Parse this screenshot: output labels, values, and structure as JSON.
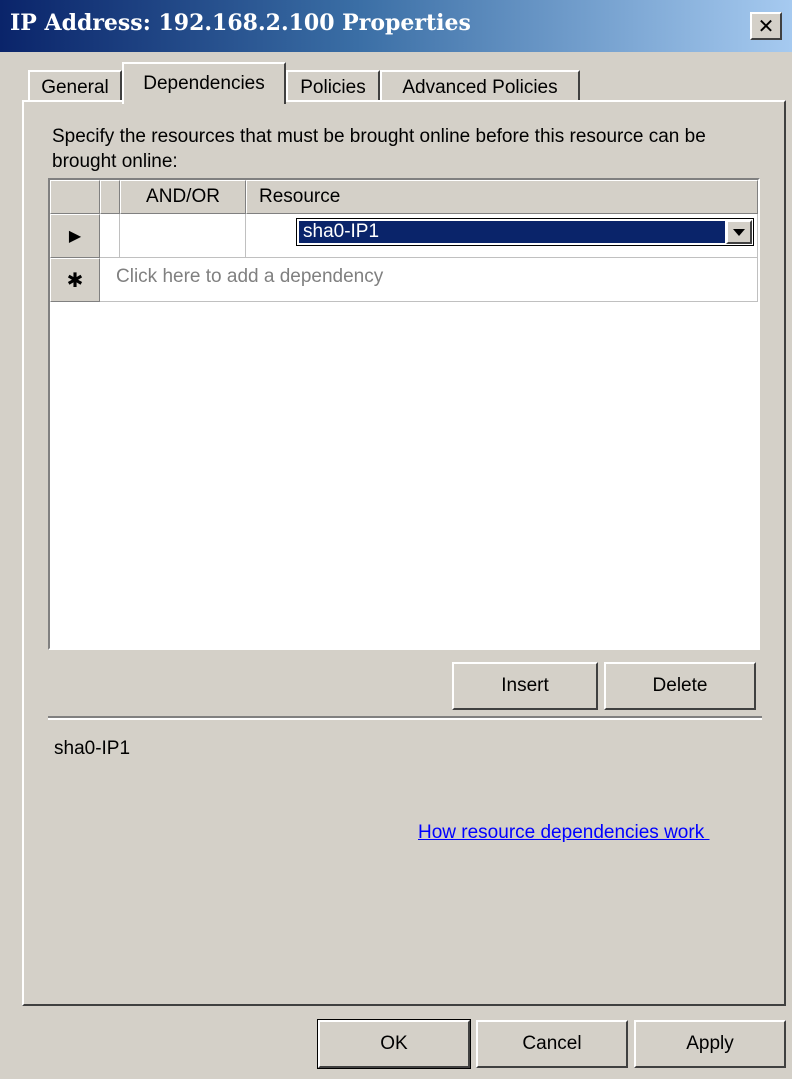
{
  "window": {
    "title": "IP Address: 192.168.2.100 Properties",
    "close_label": "✕"
  },
  "tabs": [
    {
      "label": "General",
      "active": false
    },
    {
      "label": "Dependencies",
      "active": true
    },
    {
      "label": "Policies",
      "active": false
    },
    {
      "label": "Advanced Policies",
      "active": false
    }
  ],
  "dependencies": {
    "description": "Specify the resources that must be brought online before this resource can be brought online:",
    "columns": {
      "and_or": "AND/OR",
      "resource": "Resource"
    },
    "rows": [
      {
        "and_or": "",
        "resource": "sha0-IP1",
        "marker": "▶"
      }
    ],
    "new_row": {
      "marker": "✱",
      "placeholder": "Click here to add a dependency"
    },
    "insert_label": "Insert",
    "delete_label": "Delete",
    "expression": "sha0-IP1",
    "help_link": "How resource dependencies work "
  },
  "footer": {
    "ok_label": "OK",
    "cancel_label": "Cancel",
    "apply_label": "Apply"
  },
  "colors": {
    "titlebar_start": "#0a246a",
    "titlebar_end": "#a6caf0",
    "face": "#d4d0c8",
    "selection": "#0a246a",
    "link": "#0000ff"
  }
}
